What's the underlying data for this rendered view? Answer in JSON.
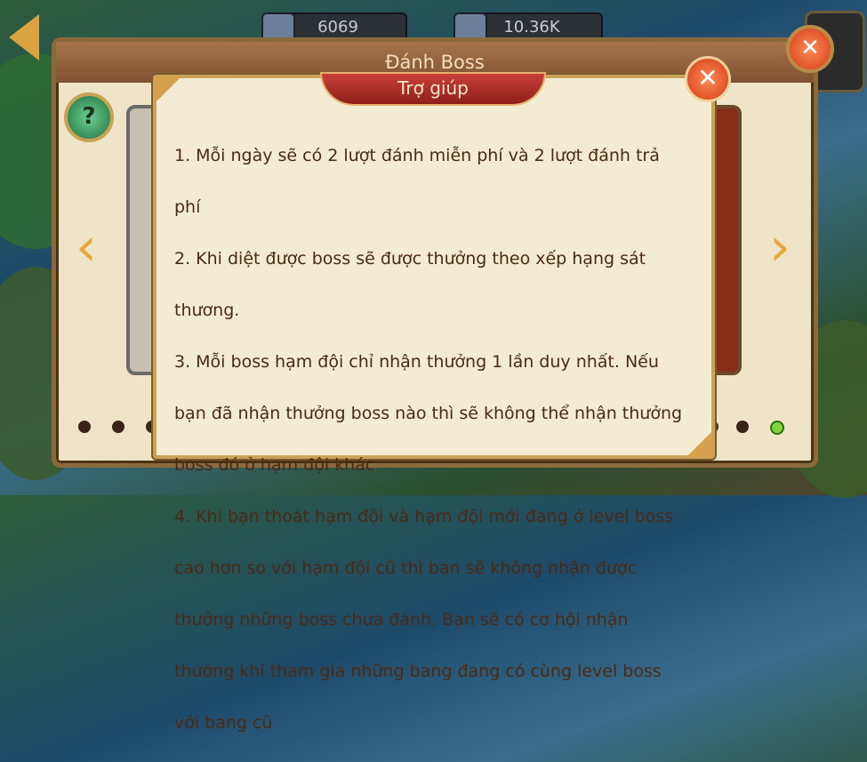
{
  "top_bar": {
    "resource_1": "6069",
    "resource_2": "10.36K"
  },
  "outer_panel": {
    "title": "Đánh Boss",
    "help_button": "?"
  },
  "help_dialog": {
    "title": "Trợ giúp",
    "close_glyph": "✕",
    "lines": [
      "1. Mỗi ngày sẽ có 2 lượt đánh miễn phí và 2 lượt đánh trả",
      "phí",
      "2. Khi diệt được boss sẽ được thưởng theo xếp hạng sát",
      "thương.",
      "3. Mỗi boss hạm đội chỉ nhận thưởng 1 lần duy nhất. Nếu",
      "bạn đã nhận thưởng boss nào thì sẽ không thể nhận thưởng",
      "boss đó ở hạm đội khác",
      "4. Khi bạn thoát hạm đội và hạm đội mới đang ở level boss",
      "cao hơn so với hạm đội cũ thì bạn sẽ không nhận được",
      "thưởng những boss chưa đánh. Bạn sẽ có cơ hội nhận",
      "thưởng khi tham gia những bang đang có cùng level boss",
      "với bang cũ"
    ]
  },
  "pagination": {
    "active_index": 6,
    "count": 7
  },
  "icons": {
    "back": "back-arrow-icon",
    "prev": "chevron-left-icon",
    "next": "chevron-right-icon",
    "close": "close-icon",
    "help": "help-icon"
  },
  "colors": {
    "dialog_bg": "#f4ebd3",
    "ribbon": "#b3302b",
    "text": "#4a2a15",
    "close": "#e2471c",
    "arrow": "#e7a83a"
  }
}
